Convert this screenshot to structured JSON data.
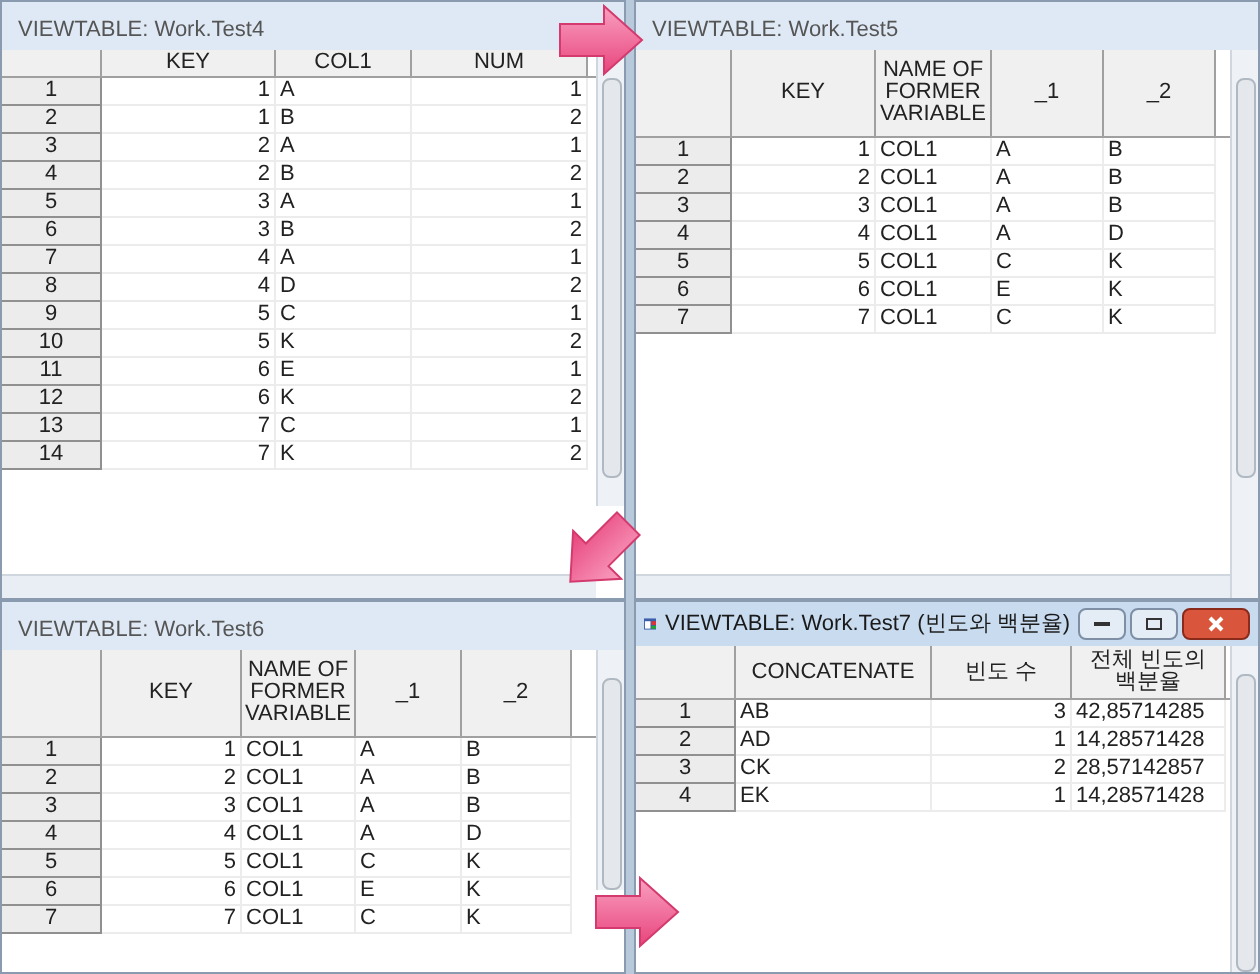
{
  "windows": [
    {
      "title": "VIEWTABLE: Work.Test4",
      "active": false,
      "columns": [
        {
          "label": "KEY",
          "numeric": true
        },
        {
          "label": "COL1",
          "numeric": false
        },
        {
          "label": "NUM",
          "numeric": true
        }
      ],
      "rows": [
        {
          "n": "1",
          "cells": [
            "1",
            "A",
            "1"
          ]
        },
        {
          "n": "2",
          "cells": [
            "1",
            "B",
            "2"
          ]
        },
        {
          "n": "3",
          "cells": [
            "2",
            "A",
            "1"
          ]
        },
        {
          "n": "4",
          "cells": [
            "2",
            "B",
            "2"
          ]
        },
        {
          "n": "5",
          "cells": [
            "3",
            "A",
            "1"
          ]
        },
        {
          "n": "6",
          "cells": [
            "3",
            "B",
            "2"
          ]
        },
        {
          "n": "7",
          "cells": [
            "4",
            "A",
            "1"
          ]
        },
        {
          "n": "8",
          "cells": [
            "4",
            "D",
            "2"
          ]
        },
        {
          "n": "9",
          "cells": [
            "5",
            "C",
            "1"
          ]
        },
        {
          "n": "10",
          "cells": [
            "5",
            "K",
            "2"
          ]
        },
        {
          "n": "11",
          "cells": [
            "6",
            "E",
            "1"
          ]
        },
        {
          "n": "12",
          "cells": [
            "6",
            "K",
            "2"
          ]
        },
        {
          "n": "13",
          "cells": [
            "7",
            "C",
            "1"
          ]
        },
        {
          "n": "14",
          "cells": [
            "7",
            "K",
            "2"
          ]
        }
      ]
    },
    {
      "title": "VIEWTABLE: Work.Test5",
      "active": false,
      "columns": [
        {
          "label": "KEY",
          "numeric": true
        },
        {
          "label": "NAME OF FORMER VARIABLE",
          "numeric": false
        },
        {
          "label": "_1",
          "numeric": false
        },
        {
          "label": "_2",
          "numeric": false
        }
      ],
      "rows": [
        {
          "n": "1",
          "cells": [
            "1",
            "COL1",
            "A",
            "B"
          ]
        },
        {
          "n": "2",
          "cells": [
            "2",
            "COL1",
            "A",
            "B"
          ]
        },
        {
          "n": "3",
          "cells": [
            "3",
            "COL1",
            "A",
            "B"
          ]
        },
        {
          "n": "4",
          "cells": [
            "4",
            "COL1",
            "A",
            "D"
          ]
        },
        {
          "n": "5",
          "cells": [
            "5",
            "COL1",
            "C",
            "K"
          ]
        },
        {
          "n": "6",
          "cells": [
            "6",
            "COL1",
            "E",
            "K"
          ]
        },
        {
          "n": "7",
          "cells": [
            "7",
            "COL1",
            "C",
            "K"
          ]
        }
      ]
    },
    {
      "title": "VIEWTABLE: Work.Test6",
      "active": false,
      "columns": [
        {
          "label": "KEY",
          "numeric": true
        },
        {
          "label": "NAME OF FORMER VARIABLE",
          "numeric": false
        },
        {
          "label": "_1",
          "numeric": false
        },
        {
          "label": "_2",
          "numeric": false
        }
      ],
      "rows": [
        {
          "n": "1",
          "cells": [
            "1",
            "COL1",
            "A",
            "B"
          ]
        },
        {
          "n": "2",
          "cells": [
            "2",
            "COL1",
            "A",
            "B"
          ]
        },
        {
          "n": "3",
          "cells": [
            "3",
            "COL1",
            "A",
            "B"
          ]
        },
        {
          "n": "4",
          "cells": [
            "4",
            "COL1",
            "A",
            "D"
          ]
        },
        {
          "n": "5",
          "cells": [
            "5",
            "COL1",
            "C",
            "K"
          ]
        },
        {
          "n": "6",
          "cells": [
            "6",
            "COL1",
            "E",
            "K"
          ]
        },
        {
          "n": "7",
          "cells": [
            "7",
            "COL1",
            "C",
            "K"
          ]
        }
      ]
    },
    {
      "title": "VIEWTABLE: Work.Test7 (빈도와 백분율)",
      "active": true,
      "columns": [
        {
          "label": "CONCATENATE",
          "numeric": false
        },
        {
          "label": "빈도 수",
          "numeric": true
        },
        {
          "label": "전체 빈도의 백분율",
          "numeric": false
        }
      ],
      "rows": [
        {
          "n": "1",
          "cells": [
            "AB",
            "3",
            "42,85714285"
          ]
        },
        {
          "n": "2",
          "cells": [
            "AD",
            "1",
            "14,28571428"
          ]
        },
        {
          "n": "3",
          "cells": [
            "CK",
            "2",
            "28,57142857"
          ]
        },
        {
          "n": "4",
          "cells": [
            "EK",
            "1",
            "14,28571428"
          ]
        }
      ]
    }
  ]
}
